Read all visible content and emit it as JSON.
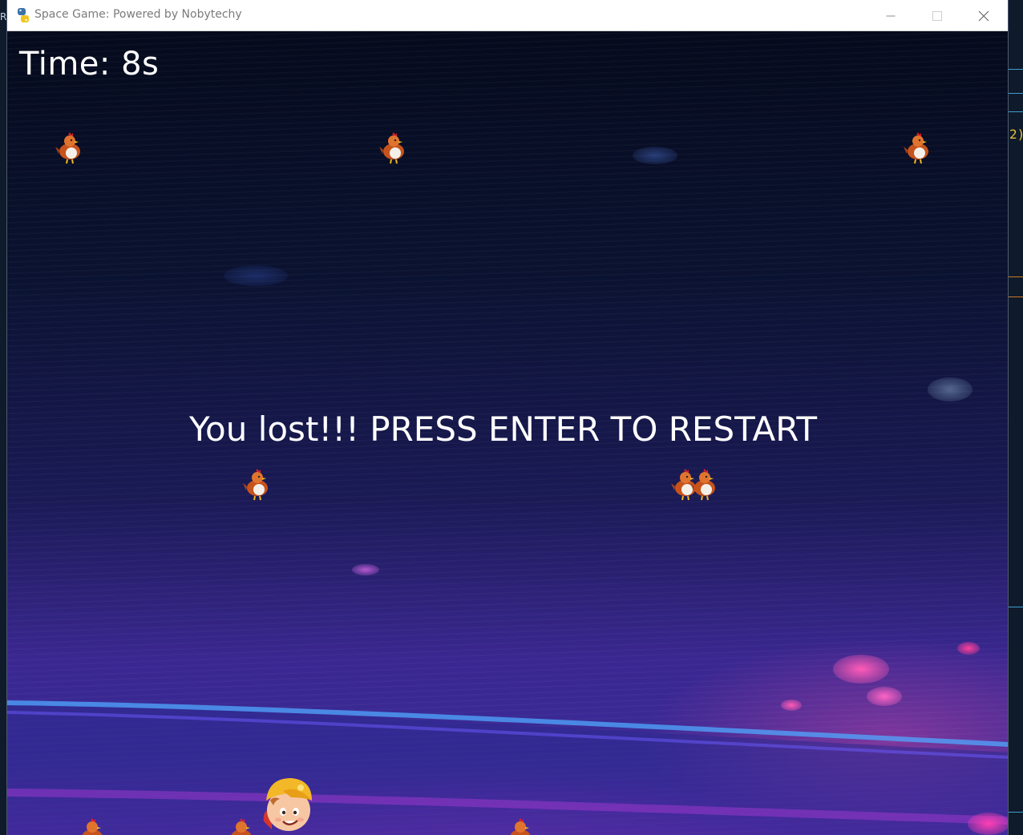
{
  "window": {
    "title": "Space Game: Powered by Nobytechy",
    "app_icon": "python-icon",
    "controls": [
      "minimize-icon",
      "maximize-icon",
      "close-icon"
    ]
  },
  "desktop": {
    "left_edge_char": "R",
    "right_edge_glyph": "2)"
  },
  "hud": {
    "timer_text": "Time: 8s"
  },
  "message": {
    "text": "You lost!!! PRESS ENTER TO RESTART"
  },
  "entities": {
    "enemy_icon": "chicken-icon",
    "player_icon": "boy-with-cap-icon"
  },
  "colors": {
    "text": "#ffffff",
    "sky_top": "#050a1c",
    "sky_bottom": "#5a2aa8",
    "horizon_glow": "#4fa8ff",
    "magenta_glow": "#ff3fb4"
  }
}
